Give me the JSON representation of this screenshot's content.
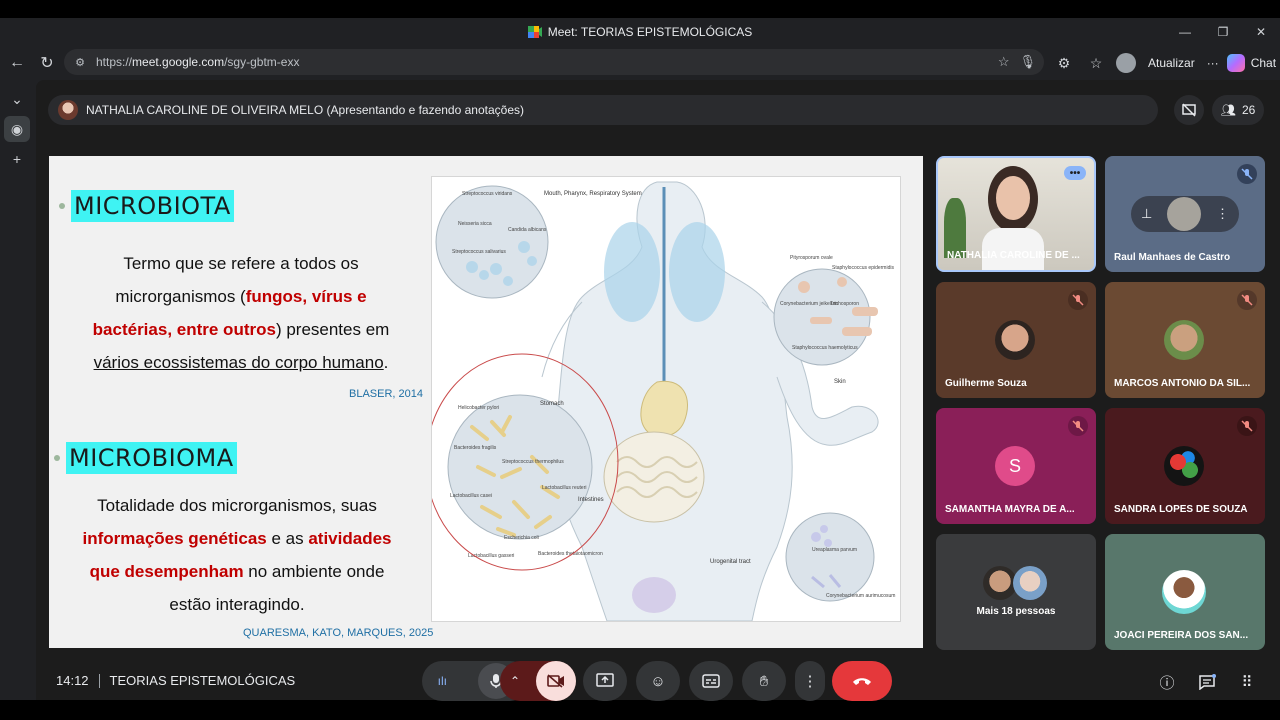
{
  "window": {
    "title": "Meet: TEORIAS EPISTEMOLÓGICAS",
    "controls": [
      "—",
      "❐",
      "✕"
    ]
  },
  "browser": {
    "url_prefix": "https://",
    "url_host": "meet.google.com",
    "url_path": "/sgy-gbtm-exx",
    "update_label": "Atualizar",
    "chat_label": "Chat",
    "more_label": "···"
  },
  "presenter": {
    "label": "NATHALIA CAROLINE DE OLIVEIRA MELO (Apresentando e fazendo anotações)"
  },
  "people_count": "26",
  "slide": {
    "heading1": "MICROBIOTA",
    "p1": {
      "a": "Termo que se refere a todos os",
      "b": "microrganismos (",
      "c": "fungos, vírus e",
      "d": "bactérias, entre outros",
      "e": ") presentes em",
      "f": "vários ecossistemas do corpo humano",
      "g": "."
    },
    "cite1": "BLASER, 2014",
    "heading2": "MICROBIOMA",
    "p2": {
      "a": "Totalidade dos microrganismos, suas",
      "b": "informações genéticas",
      "c": " e as ",
      "d": "atividades",
      "e": "que desempenham",
      "f": " no ambiente onde",
      "g": "estão interagindo."
    },
    "cite2": "QUARESMA, KATO, MARQUES, 2025",
    "figure_labels": {
      "mouth": "Mouth, Pharynx, Respiratory System",
      "strep_viridans": "Streptococcus viridans",
      "neisseria": "Neisseria sicca",
      "candida": "Candida albicans",
      "strep_salivarius": "Streptococcus salivarius",
      "pityro": "Pityrosporum ovale",
      "staph_epi": "Staphylococcus epidermidis",
      "coryne_j": "Corynebacterium jeikeium",
      "tricho": "Trichosporon",
      "staph_haem": "Staphylococcus haemolyticus",
      "skin": "Skin",
      "stomach": "Stomach",
      "helico": "Helicobacter pylori",
      "bacteroides_f": "Bacteroides fragilis",
      "strep_thermo": "Streptococcus thermophilus",
      "lacto_reuteri": "Lactobacillus reuteri",
      "intestines": "Intestines",
      "lacto_casei": "Lactobacillus casei",
      "ecoli": "Escherichia coli",
      "lacto_gasseri": "Lactobacillus gasseri",
      "bacteroides_t": "Bacteroides thetaiotaomicron",
      "urogenital": "Urogenital tract",
      "ureaplasma": "Ureaplasma parvum",
      "coryne_a": "Corynebacterium aurimucosum"
    }
  },
  "participants": [
    {
      "name": "NATHALIA CAROLINE DE ...",
      "muted": false
    },
    {
      "name": "Raul Manhaes de Castro",
      "muted": true
    },
    {
      "name": "Guilherme Souza",
      "muted": true
    },
    {
      "name": "MARCOS ANTONIO DA SIL...",
      "muted": true
    },
    {
      "name": "SAMANTHA MAYRA DE A...",
      "muted": true,
      "initial": "S"
    },
    {
      "name": "SANDRA LOPES DE SOUZA",
      "muted": true
    },
    {
      "name": "Mais 18 pessoas",
      "muted": false
    },
    {
      "name": "JOACI PEREIRA DOS SAN...",
      "muted": false
    }
  ],
  "meeting": {
    "time": "14:12",
    "title": "TEORIAS EPISTEMOLÓGICAS"
  },
  "colors": {
    "end_call": "#e5383b",
    "camera_off_bg": "#f9dedc",
    "highlight": "#3ff3f3",
    "emphasis_red": "#c00000"
  }
}
